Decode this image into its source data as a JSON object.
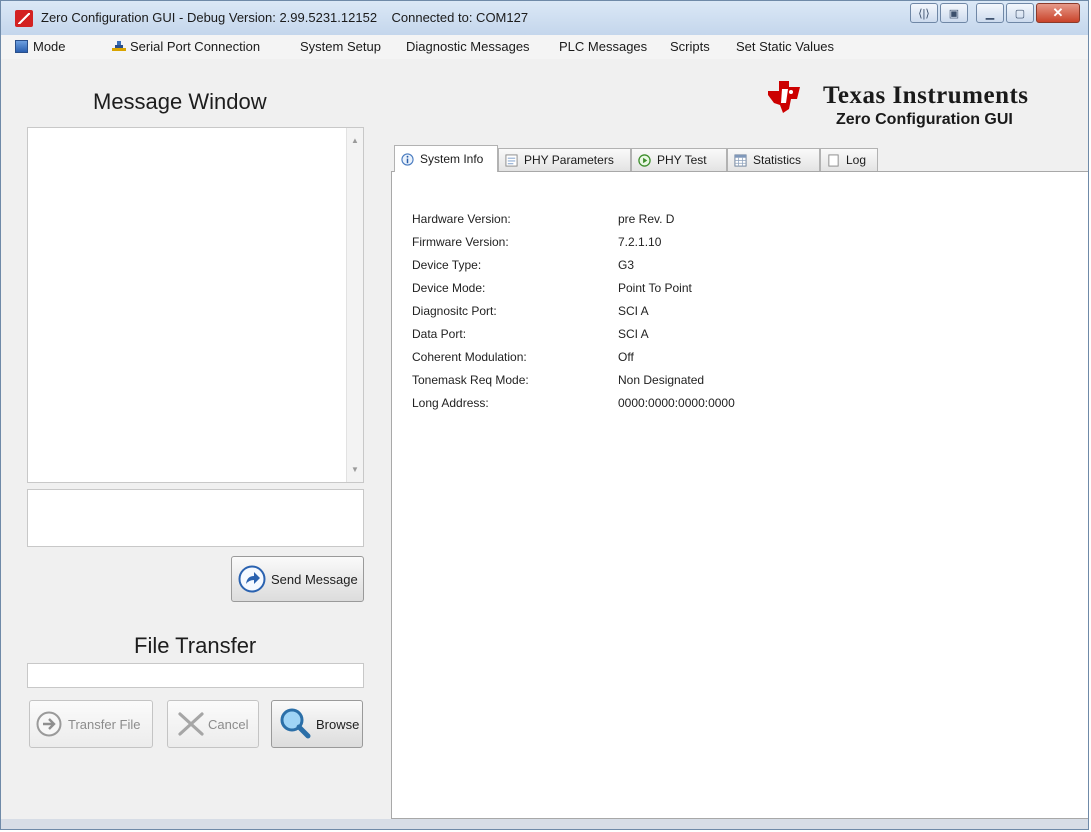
{
  "window": {
    "title": "Zero Configuration GUI - Debug Version: 2.99.5231.12152",
    "connection": "Connected to: COM127"
  },
  "menu": [
    "Mode",
    "Serial Port Connection",
    "System Setup",
    "Diagnostic Messages",
    "PLC Messages",
    "Scripts",
    "Set Static Values"
  ],
  "left_panel": {
    "message_window_title": "Message Window",
    "send_button": "Send Message",
    "file_transfer_title": "File Transfer",
    "transfer_button": "Transfer File",
    "cancel_button": "Cancel",
    "browse_button": "Browse"
  },
  "brand": {
    "name": "Texas Instruments",
    "subtitle": "Zero Configuration GUI",
    "color": "#cc0000"
  },
  "tabs": [
    "System Info",
    "PHY Parameters",
    "PHY Test",
    "Statistics",
    "Log"
  ],
  "active_tab": 0,
  "system_info": [
    {
      "label": "Hardware Version:",
      "value": "pre Rev. D"
    },
    {
      "label": "Firmware Version:",
      "value": "7.2.1.10"
    },
    {
      "label": "Device Type:",
      "value": "G3"
    },
    {
      "label": "Device Mode:",
      "value": "Point To Point"
    },
    {
      "label": "Diagnositc Port:",
      "value": "SCI A"
    },
    {
      "label": "Data Port:",
      "value": "SCI A"
    },
    {
      "label": "Coherent Modulation:",
      "value": "Off"
    },
    {
      "label": "Tonemask Req Mode:",
      "value": "Non Designated"
    },
    {
      "label": "Long Address:",
      "value": "0000:0000:0000:0000"
    }
  ]
}
